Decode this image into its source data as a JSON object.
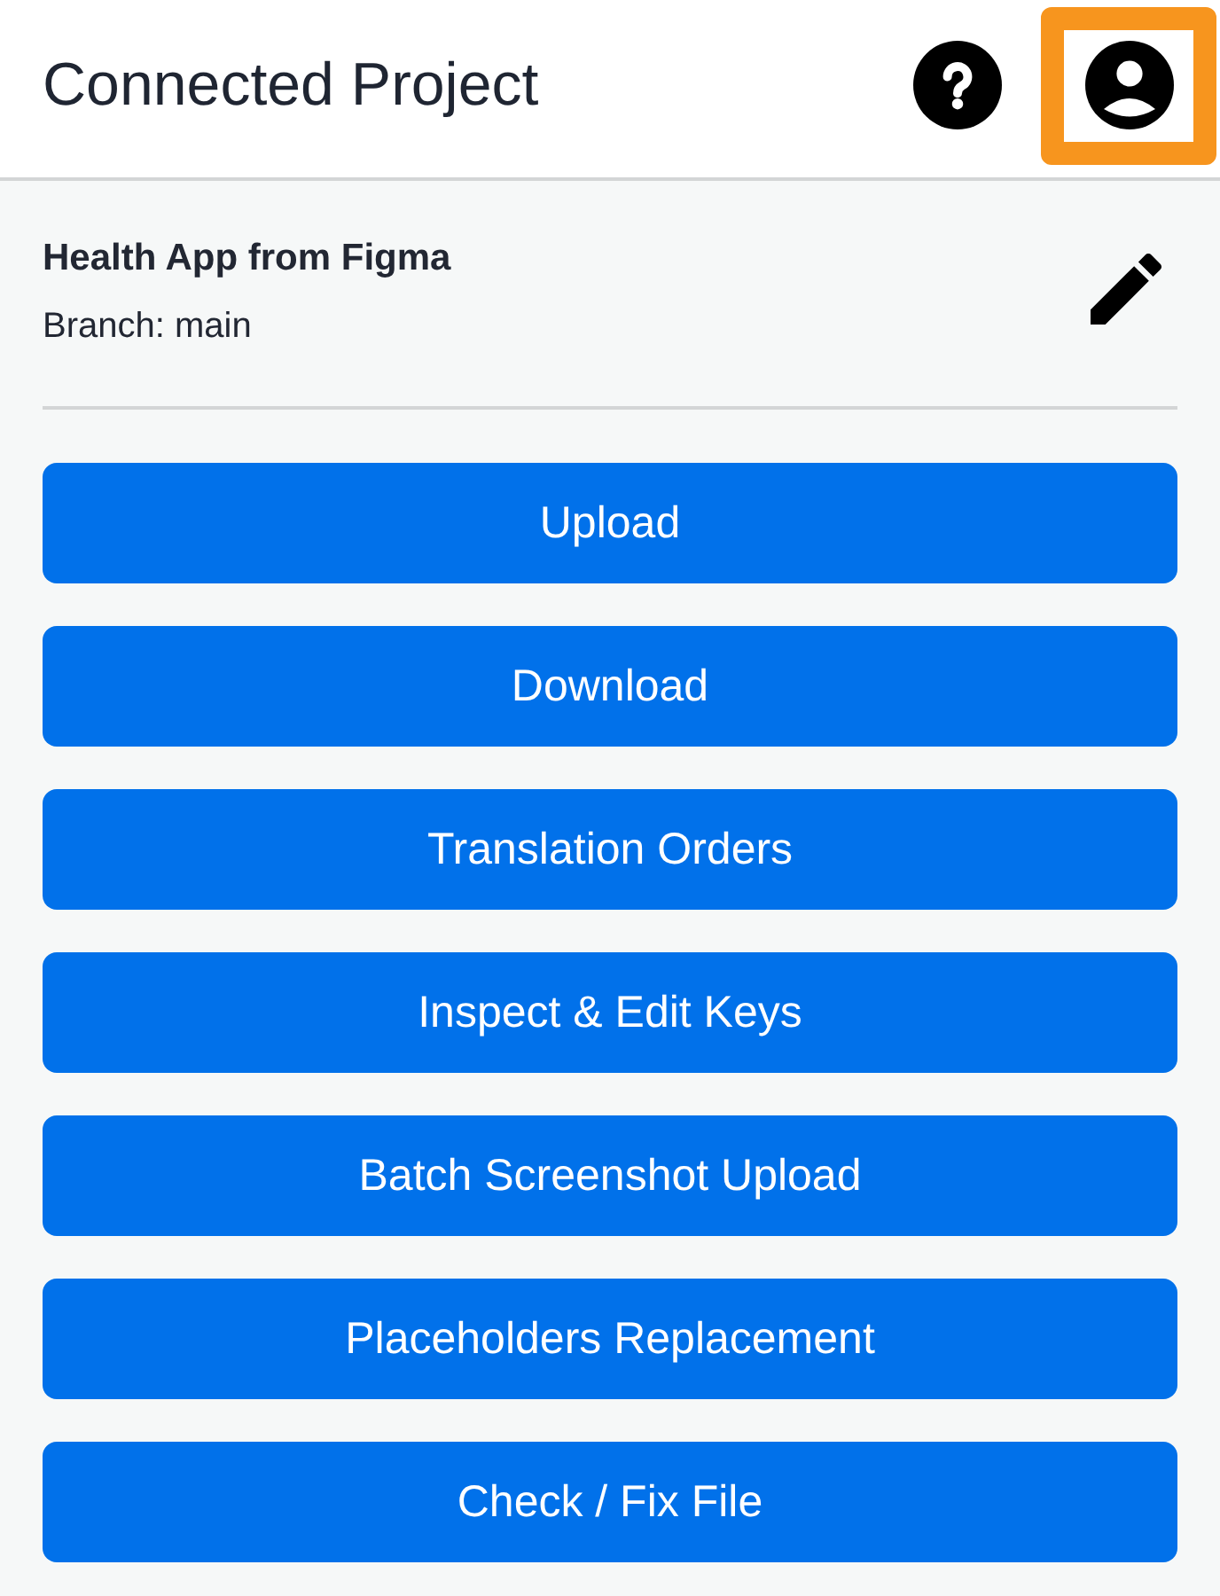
{
  "header": {
    "title": "Connected Project",
    "account_button": {
      "highlighted": true
    }
  },
  "project": {
    "name": "Health App from Figma",
    "branch": "Branch: main"
  },
  "actions": [
    {
      "label": "Upload"
    },
    {
      "label": "Download"
    },
    {
      "label": "Translation Orders"
    },
    {
      "label": "Inspect & Edit Keys"
    },
    {
      "label": "Batch Screenshot Upload"
    },
    {
      "label": "Placeholders Replacement"
    },
    {
      "label": "Check / Fix File"
    }
  ]
}
